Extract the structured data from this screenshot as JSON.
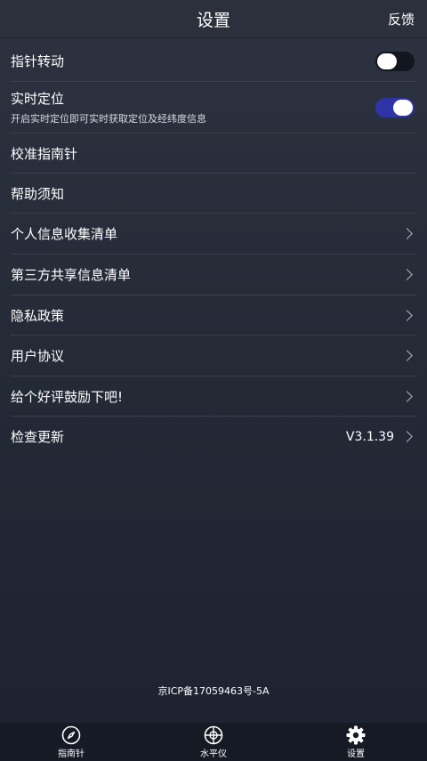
{
  "header": {
    "title": "设置",
    "feedback": "反馈"
  },
  "rows": {
    "pointer_rotate": {
      "label": "指针转动",
      "toggle": "off"
    },
    "realtime_location": {
      "label": "实时定位",
      "subtitle": "开启实时定位即可实时获取定位及经纬度信息",
      "toggle": "on"
    },
    "calibrate": {
      "label": "校准指南针"
    },
    "help": {
      "label": "帮助须知"
    },
    "personal_info": {
      "label": "个人信息收集清单"
    },
    "third_party": {
      "label": "第三方共享信息清单"
    },
    "privacy": {
      "label": "隐私政策"
    },
    "user_agreement": {
      "label": "用户协议"
    },
    "rate": {
      "label": "给个好评鼓励下吧!"
    },
    "update": {
      "label": "检查更新",
      "version": "V3.1.39"
    }
  },
  "footer": {
    "icp": "京ICP备17059463号-5A"
  },
  "tabs": [
    {
      "label": "指南针",
      "icon": "compass-icon"
    },
    {
      "label": "水平仪",
      "icon": "level-icon"
    },
    {
      "label": "设置",
      "icon": "gear-icon"
    }
  ],
  "colors": {
    "toggle_on": "#2e33a8",
    "toggle_off": "#12161f",
    "background": "#252a37"
  }
}
